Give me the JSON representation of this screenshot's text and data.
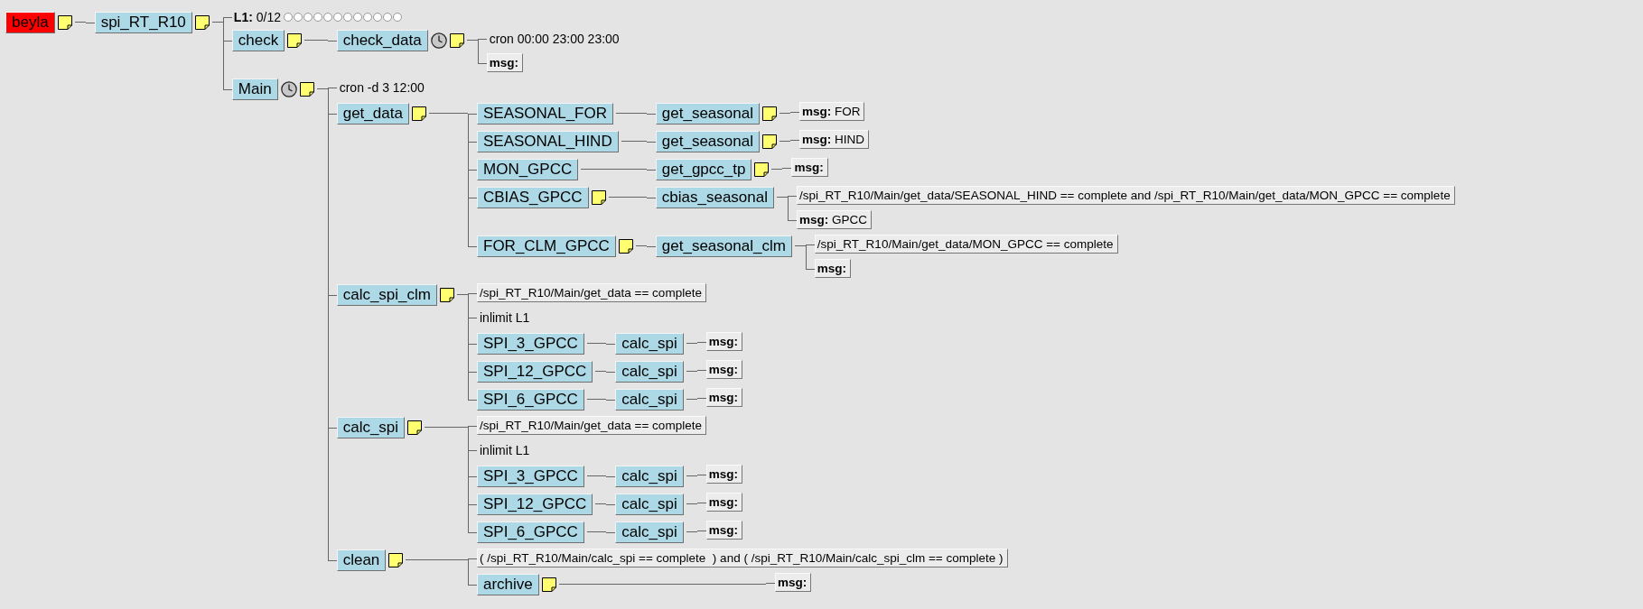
{
  "tree": [
    {
      "kind": "node",
      "name": "beyla",
      "color": "#ff0000",
      "note": true,
      "children": [
        {
          "kind": "node",
          "name": "spi_RT_R10",
          "color": "#add8e6",
          "note": true,
          "children": [
            {
              "kind": "limit",
              "name": "L1:",
              "value": "0/12"
            },
            {
              "kind": "node",
              "name": "check",
              "color": "#add8e6",
              "note": true,
              "children": [
                {
                  "kind": "node",
                  "name": "check_data",
                  "color": "#add8e6",
                  "clock": true,
                  "note": true,
                  "children": [
                    {
                      "kind": "text",
                      "text": "cron 00:00 23:00 23:00"
                    },
                    {
                      "kind": "msg",
                      "label": "msg:"
                    }
                  ]
                }
              ]
            },
            {
              "kind": "node",
              "name": "Main",
              "color": "#add8e6",
              "clock": true,
              "note": true,
              "children": [
                {
                  "kind": "text",
                  "text": "cron -d 3 12:00"
                },
                {
                  "kind": "node",
                  "name": "get_data",
                  "color": "#add8e6",
                  "note": true,
                  "children": [
                    {
                      "kind": "node",
                      "name": "SEASONAL_FOR",
                      "color": "#add8e6",
                      "children": [
                        {
                          "kind": "node",
                          "name": "get_seasonal",
                          "color": "#add8e6",
                          "note": true,
                          "children": [
                            {
                              "kind": "msg",
                              "label": "msg:",
                              "value": "FOR"
                            }
                          ]
                        }
                      ]
                    },
                    {
                      "kind": "node",
                      "name": "SEASONAL_HIND",
                      "color": "#add8e6",
                      "children": [
                        {
                          "kind": "node",
                          "name": "get_seasonal",
                          "color": "#add8e6",
                          "note": true,
                          "children": [
                            {
                              "kind": "msg",
                              "label": "msg:",
                              "value": "HIND"
                            }
                          ]
                        }
                      ]
                    },
                    {
                      "kind": "node",
                      "name": "MON_GPCC",
                      "color": "#add8e6",
                      "children": [
                        {
                          "kind": "node",
                          "name": "get_gpcc_tp",
                          "color": "#add8e6",
                          "note": true,
                          "children": [
                            {
                              "kind": "msg",
                              "label": "msg:"
                            }
                          ]
                        }
                      ]
                    },
                    {
                      "kind": "node",
                      "name": "CBIAS_GPCC",
                      "color": "#add8e6",
                      "note": true,
                      "children": [
                        {
                          "kind": "node",
                          "name": "cbias_seasonal",
                          "color": "#add8e6",
                          "children": [
                            {
                              "kind": "trigger",
                              "text": "/spi_RT_R10/Main/get_data/SEASONAL_HIND == complete and /spi_RT_R10/Main/get_data/MON_GPCC == complete"
                            },
                            {
                              "kind": "msg",
                              "label": "msg:",
                              "value": "GPCC"
                            }
                          ]
                        }
                      ]
                    },
                    {
                      "kind": "node",
                      "name": "FOR_CLM_GPCC",
                      "color": "#add8e6",
                      "note": true,
                      "children": [
                        {
                          "kind": "node",
                          "name": "get_seasonal_clm",
                          "color": "#add8e6",
                          "children": [
                            {
                              "kind": "trigger",
                              "text": "/spi_RT_R10/Main/get_data/MON_GPCC == complete"
                            },
                            {
                              "kind": "msg",
                              "label": "msg:"
                            }
                          ]
                        }
                      ]
                    }
                  ]
                },
                {
                  "kind": "node",
                  "name": "calc_spi_clm",
                  "color": "#add8e6",
                  "note": true,
                  "children": [
                    {
                      "kind": "trigger",
                      "text": "/spi_RT_R10/Main/get_data == complete"
                    },
                    {
                      "kind": "text",
                      "text": "inlimit L1"
                    },
                    {
                      "kind": "node",
                      "name": "SPI_3_GPCC",
                      "color": "#add8e6",
                      "children": [
                        {
                          "kind": "node",
                          "name": "calc_spi",
                          "color": "#add8e6",
                          "children": [
                            {
                              "kind": "msg",
                              "label": "msg:"
                            }
                          ]
                        }
                      ]
                    },
                    {
                      "kind": "node",
                      "name": "SPI_12_GPCC",
                      "color": "#add8e6",
                      "children": [
                        {
                          "kind": "node",
                          "name": "calc_spi",
                          "color": "#add8e6",
                          "children": [
                            {
                              "kind": "msg",
                              "label": "msg:"
                            }
                          ]
                        }
                      ]
                    },
                    {
                      "kind": "node",
                      "name": "SPI_6_GPCC",
                      "color": "#add8e6",
                      "children": [
                        {
                          "kind": "node",
                          "name": "calc_spi",
                          "color": "#add8e6",
                          "children": [
                            {
                              "kind": "msg",
                              "label": "msg:"
                            }
                          ]
                        }
                      ]
                    }
                  ]
                },
                {
                  "kind": "node",
                  "name": "calc_spi",
                  "color": "#add8e6",
                  "note": true,
                  "children": [
                    {
                      "kind": "trigger",
                      "text": "/spi_RT_R10/Main/get_data == complete"
                    },
                    {
                      "kind": "text",
                      "text": "inlimit L1"
                    },
                    {
                      "kind": "node",
                      "name": "SPI_3_GPCC",
                      "color": "#add8e6",
                      "children": [
                        {
                          "kind": "node",
                          "name": "calc_spi",
                          "color": "#add8e6",
                          "children": [
                            {
                              "kind": "msg",
                              "label": "msg:"
                            }
                          ]
                        }
                      ]
                    },
                    {
                      "kind": "node",
                      "name": "SPI_12_GPCC",
                      "color": "#add8e6",
                      "children": [
                        {
                          "kind": "node",
                          "name": "calc_spi",
                          "color": "#add8e6",
                          "children": [
                            {
                              "kind": "msg",
                              "label": "msg:"
                            }
                          ]
                        }
                      ]
                    },
                    {
                      "kind": "node",
                      "name": "SPI_6_GPCC",
                      "color": "#add8e6",
                      "children": [
                        {
                          "kind": "node",
                          "name": "calc_spi",
                          "color": "#add8e6",
                          "children": [
                            {
                              "kind": "msg",
                              "label": "msg:"
                            }
                          ]
                        }
                      ]
                    }
                  ]
                },
                {
                  "kind": "node",
                  "name": "clean",
                  "color": "#add8e6",
                  "note": true,
                  "children": [
                    {
                      "kind": "trigger",
                      "text": "( /spi_RT_R10/Main/calc_spi == complete  ) and ( /spi_RT_R10/Main/calc_spi_clm == complete )"
                    },
                    {
                      "kind": "node",
                      "name": "archive",
                      "color": "#add8e6",
                      "note": true,
                      "children": [
                        {
                          "kind": "msg",
                          "label": "msg:"
                        }
                      ]
                    }
                  ]
                }
              ]
            }
          ]
        }
      ]
    }
  ]
}
